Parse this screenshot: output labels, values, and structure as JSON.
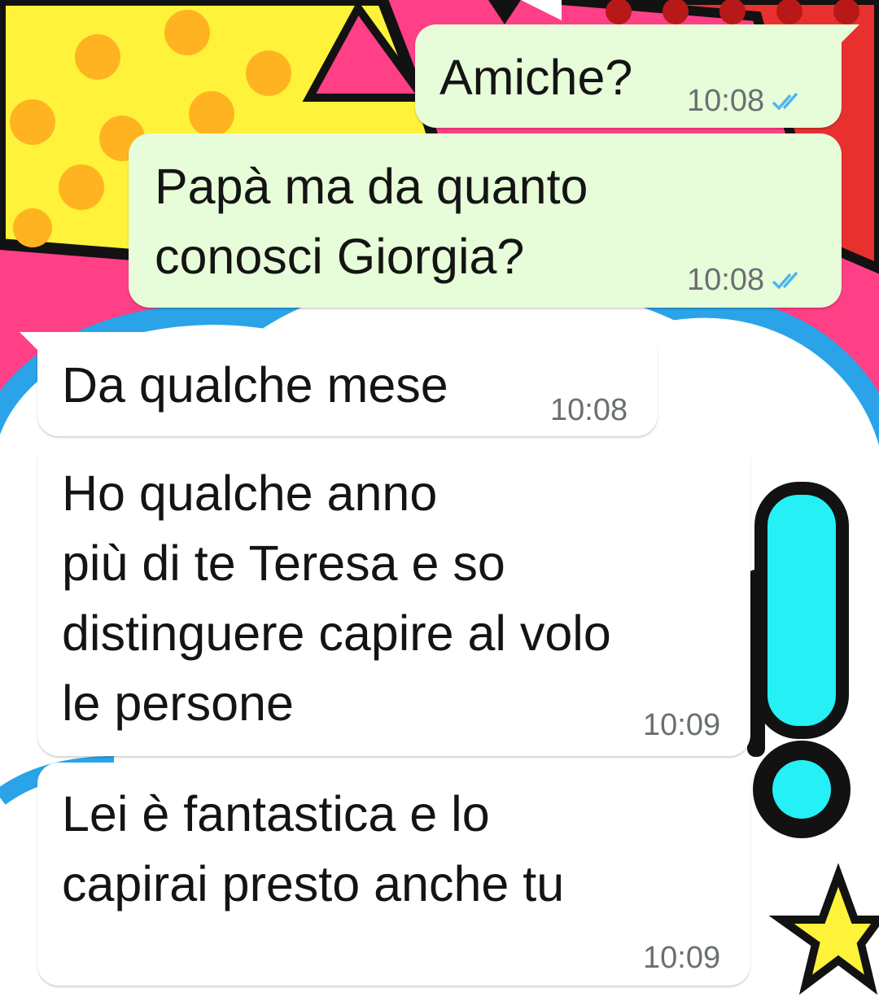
{
  "messages": [
    {
      "direction": "outgoing",
      "text": "Amiche?",
      "time": "10:08",
      "status": "read-double-check-icon"
    },
    {
      "direction": "outgoing",
      "text": "Papà ma da quanto\nconosci Giorgia?",
      "time": "10:08",
      "status": "read-double-check-icon"
    },
    {
      "direction": "incoming",
      "text": "Da qualche mese",
      "time": "10:08"
    },
    {
      "direction": "incoming",
      "text": "Ho qualche anno\npiù di te Teresa e so\ndistinguere capire al volo\nle persone",
      "time": "10:09"
    },
    {
      "direction": "incoming",
      "text": "Lei è fantastica e lo\ncapirai presto anche tu",
      "time": "10:09"
    }
  ],
  "colors": {
    "outgoing_bubble": "#e7fcd8",
    "incoming_bubble": "#ffffff",
    "read_ticks": "#4fb6ec",
    "time_text": "#6a6f72"
  }
}
